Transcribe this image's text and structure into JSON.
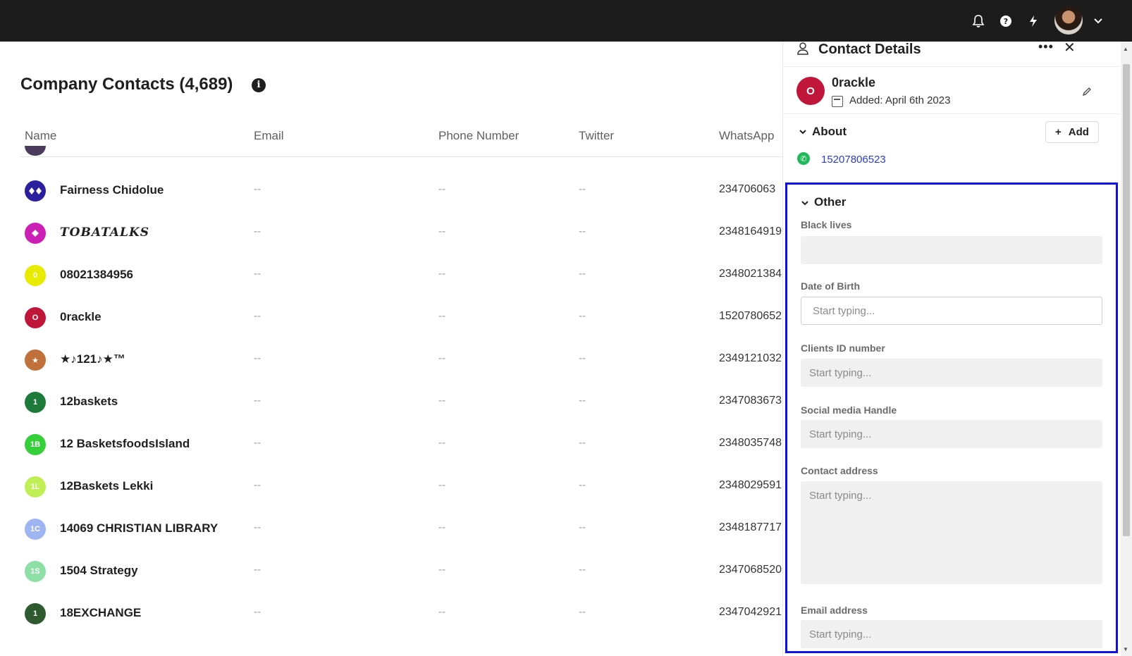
{
  "topbar": {
    "icons": [
      "bell-icon",
      "help-icon",
      "lightning-icon",
      "chevron-down-icon"
    ]
  },
  "page": {
    "title": "Company Contacts (4,689)",
    "info_icon": "info-icon"
  },
  "table": {
    "columns": [
      "Name",
      "Email",
      "Phone Number",
      "Twitter",
      "WhatsApp"
    ],
    "empty_value": "--",
    "rows": [
      {
        "initials": "",
        "avatar_color": "#2b1f9e",
        "name": "Fairness Chidolue",
        "whatsapp": "234706063",
        "serif": false,
        "glyph": "diamonds"
      },
      {
        "initials": "",
        "avatar_color": "#cc1fb5",
        "name": "TOBATALKS",
        "whatsapp": "2348164919",
        "serif": true,
        "glyph": "diamond"
      },
      {
        "initials": "0",
        "avatar_color": "#e8ea00",
        "name": "08021384956",
        "whatsapp": "2348021384",
        "serif": false
      },
      {
        "initials": "O",
        "avatar_color": "#c0163a",
        "name": "0rackle",
        "whatsapp": "1520780652",
        "serif": false
      },
      {
        "initials": "★",
        "avatar_color": "#c0703a",
        "name": "★♪121♪★™",
        "whatsapp": "2349121032",
        "serif": false
      },
      {
        "initials": "1",
        "avatar_color": "#1e7a3a",
        "name": "12baskets",
        "whatsapp": "2347083673",
        "serif": false
      },
      {
        "initials": "1B",
        "avatar_color": "#35cf3a",
        "name": "12 BasketsfoodsIsland",
        "whatsapp": "2348035748",
        "serif": false
      },
      {
        "initials": "1L",
        "avatar_color": "#bfef55",
        "name": "12Baskets Lekki",
        "whatsapp": "2348029591",
        "serif": false
      },
      {
        "initials": "1C",
        "avatar_color": "#9fb4f2",
        "name": "14069 CHRISTIAN LIBRARY",
        "whatsapp": "2348187717",
        "serif": false
      },
      {
        "initials": "1S",
        "avatar_color": "#8ddfa6",
        "name": "1504 Strategy",
        "whatsapp": "2347068520",
        "serif": false
      },
      {
        "initials": "1",
        "avatar_color": "#2f5a30",
        "name": "18EXCHANGE",
        "whatsapp": "2347042921",
        "serif": false
      }
    ]
  },
  "panel": {
    "title": "Contact Details",
    "contact": {
      "initials": "O",
      "name": "0rackle",
      "added": "Added: April 6th 2023"
    },
    "about": {
      "title": "About",
      "add_label": "Add",
      "whatsapp_number": "15207806523"
    },
    "other": {
      "title": "Other",
      "fields": [
        {
          "label": "Black lives",
          "value": "",
          "placeholder": ""
        },
        {
          "label": "Date of Birth",
          "value": "",
          "placeholder": "Start typing..."
        },
        {
          "label": "Clients ID number",
          "value": "",
          "placeholder": "Start typing..."
        },
        {
          "label": "Social media Handle",
          "value": "",
          "placeholder": "Start typing..."
        },
        {
          "label": "Contact address",
          "value": "",
          "placeholder": "Start typing..."
        },
        {
          "label": "Email address",
          "value": "",
          "placeholder": "Start typing..."
        }
      ]
    }
  }
}
